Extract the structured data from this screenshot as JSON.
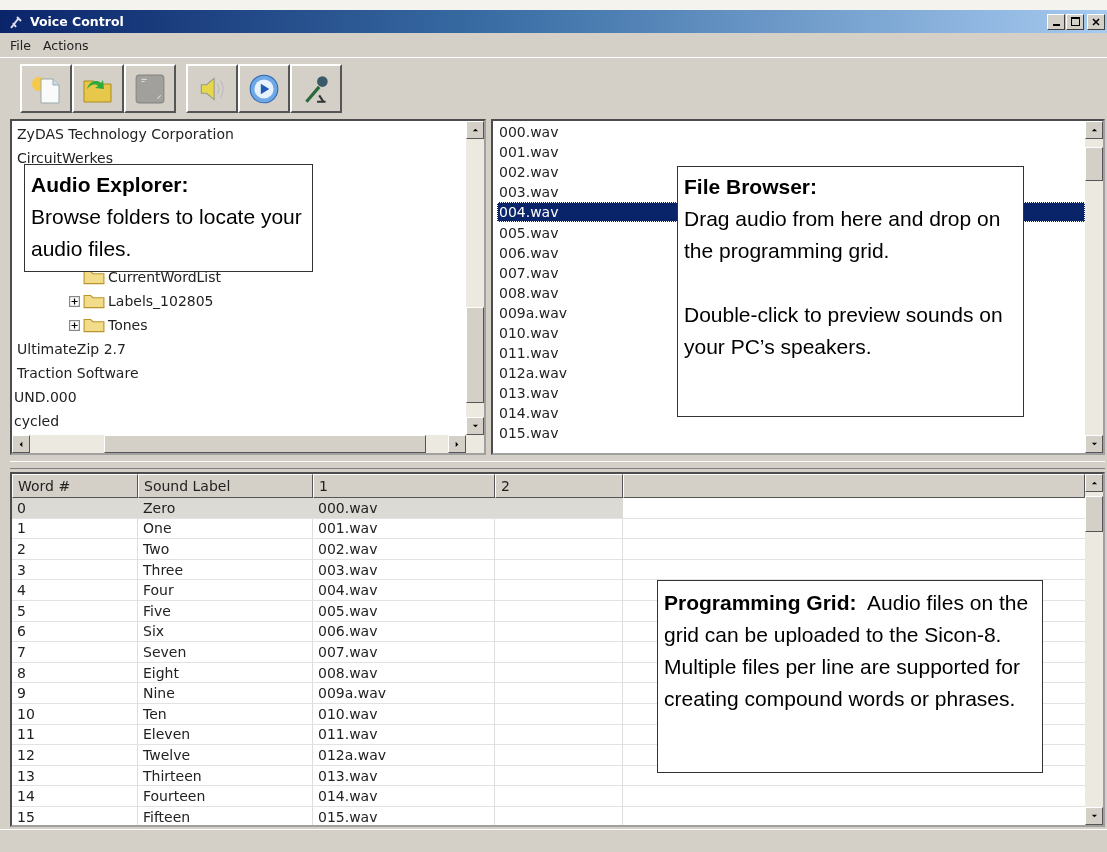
{
  "window": {
    "title": "Voice Control"
  },
  "menu": [
    "File",
    "Actions"
  ],
  "toolbar": [
    {
      "kind": "new",
      "disabled": false
    },
    {
      "kind": "open",
      "disabled": false
    },
    {
      "kind": "blank",
      "disabled": true
    },
    {
      "kind": "speaker",
      "disabled": false
    },
    {
      "kind": "play",
      "disabled": false
    },
    {
      "kind": "microphone",
      "disabled": false
    }
  ],
  "explorer": {
    "items": [
      {
        "label": "ZyDAS Technology Corporation",
        "kind": "entry"
      },
      {
        "label": "CircuitWerkes",
        "kind": "entry"
      },
      {
        "kind": "hidden"
      },
      {
        "kind": "hidden"
      },
      {
        "kind": "hidden"
      },
      {
        "kind": "hidden"
      },
      {
        "label": "CurrentWordList",
        "kind": "folder",
        "expandable": false
      },
      {
        "label": "Labels_102805",
        "kind": "folder",
        "expandable": true
      },
      {
        "label": "Tones",
        "kind": "folder",
        "expandable": true
      },
      {
        "label": "UltimateZip 2.7",
        "kind": "entry"
      },
      {
        "label": "Traction Software",
        "kind": "entry"
      },
      {
        "label": "UND.000",
        "kind": "clipped"
      },
      {
        "label": "cycled",
        "kind": "clipped"
      }
    ]
  },
  "files": [
    {
      "name": "000.wav",
      "selected": false
    },
    {
      "name": "001.wav",
      "selected": false
    },
    {
      "name": "002.wav",
      "selected": false
    },
    {
      "name": "003.wav",
      "selected": false
    },
    {
      "name": "004.wav",
      "selected": true
    },
    {
      "name": "005.wav",
      "selected": false
    },
    {
      "name": "006.wav",
      "selected": false
    },
    {
      "name": "007.wav",
      "selected": false
    },
    {
      "name": "008.wav",
      "selected": false
    },
    {
      "name": "009a.wav",
      "selected": false
    },
    {
      "name": "010.wav",
      "selected": false
    },
    {
      "name": "011.wav",
      "selected": false
    },
    {
      "name": "012a.wav",
      "selected": false
    },
    {
      "name": "013.wav",
      "selected": false
    },
    {
      "name": "014.wav",
      "selected": false
    },
    {
      "name": "015.wav",
      "selected": false
    }
  ],
  "grid": {
    "columns": [
      "Word #",
      "Sound Label",
      "1",
      "2"
    ],
    "rows": [
      {
        "word": "0",
        "label": "Zero",
        "file_1": "000.wav",
        "selected": true
      },
      {
        "word": "1",
        "label": "One",
        "file_1": "001.wav",
        "selected": false
      },
      {
        "word": "2",
        "label": "Two",
        "file_1": "002.wav",
        "selected": false
      },
      {
        "word": "3",
        "label": "Three",
        "file_1": "003.wav",
        "selected": false
      },
      {
        "word": "4",
        "label": "Four",
        "file_1": "004.wav",
        "selected": false
      },
      {
        "word": "5",
        "label": "Five",
        "file_1": "005.wav",
        "selected": false
      },
      {
        "word": "6",
        "label": "Six",
        "file_1": "006.wav",
        "selected": false
      },
      {
        "word": "7",
        "label": "Seven",
        "file_1": "007.wav",
        "selected": false
      },
      {
        "word": "8",
        "label": "Eight",
        "file_1": "008.wav",
        "selected": false
      },
      {
        "word": "9",
        "label": "Nine",
        "file_1": "009a.wav",
        "selected": false
      },
      {
        "word": "10",
        "label": "Ten",
        "file_1": "010.wav",
        "selected": false
      },
      {
        "word": "11",
        "label": "Eleven",
        "file_1": "011.wav",
        "selected": false
      },
      {
        "word": "12",
        "label": "Twelve",
        "file_1": "012a.wav",
        "selected": false
      },
      {
        "word": "13",
        "label": "Thirteen",
        "file_1": "013.wav",
        "selected": false
      },
      {
        "word": "14",
        "label": "Fourteen",
        "file_1": "014.wav",
        "selected": false
      },
      {
        "word": "15",
        "label": "Fifteen",
        "file_1": "015.wav",
        "selected": false
      }
    ]
  },
  "callouts": [
    {
      "kind": "explorer",
      "paragraphs": [
        {
          "kind": "heading",
          "text": "Audio Explorer:"
        },
        {
          "kind": "body",
          "text": "Browse folders to locate your audio files."
        }
      ]
    },
    {
      "kind": "browser",
      "paragraphs": [
        {
          "kind": "heading",
          "text": "File Browser:"
        },
        {
          "kind": "body",
          "text": "Drag audio from here and drop on the programming grid."
        },
        {
          "kind": "body",
          "text": "Double-click to preview sounds on your PC’s speakers."
        }
      ]
    },
    {
      "kind": "grid",
      "paragraphs": [
        {
          "kind": "body",
          "text": "**Programming Grid:**  Audio files on the grid can be uploaded to the Sicon-8.  Multiple files per line are supported for creating compound words or phrases."
        }
      ]
    }
  ]
}
